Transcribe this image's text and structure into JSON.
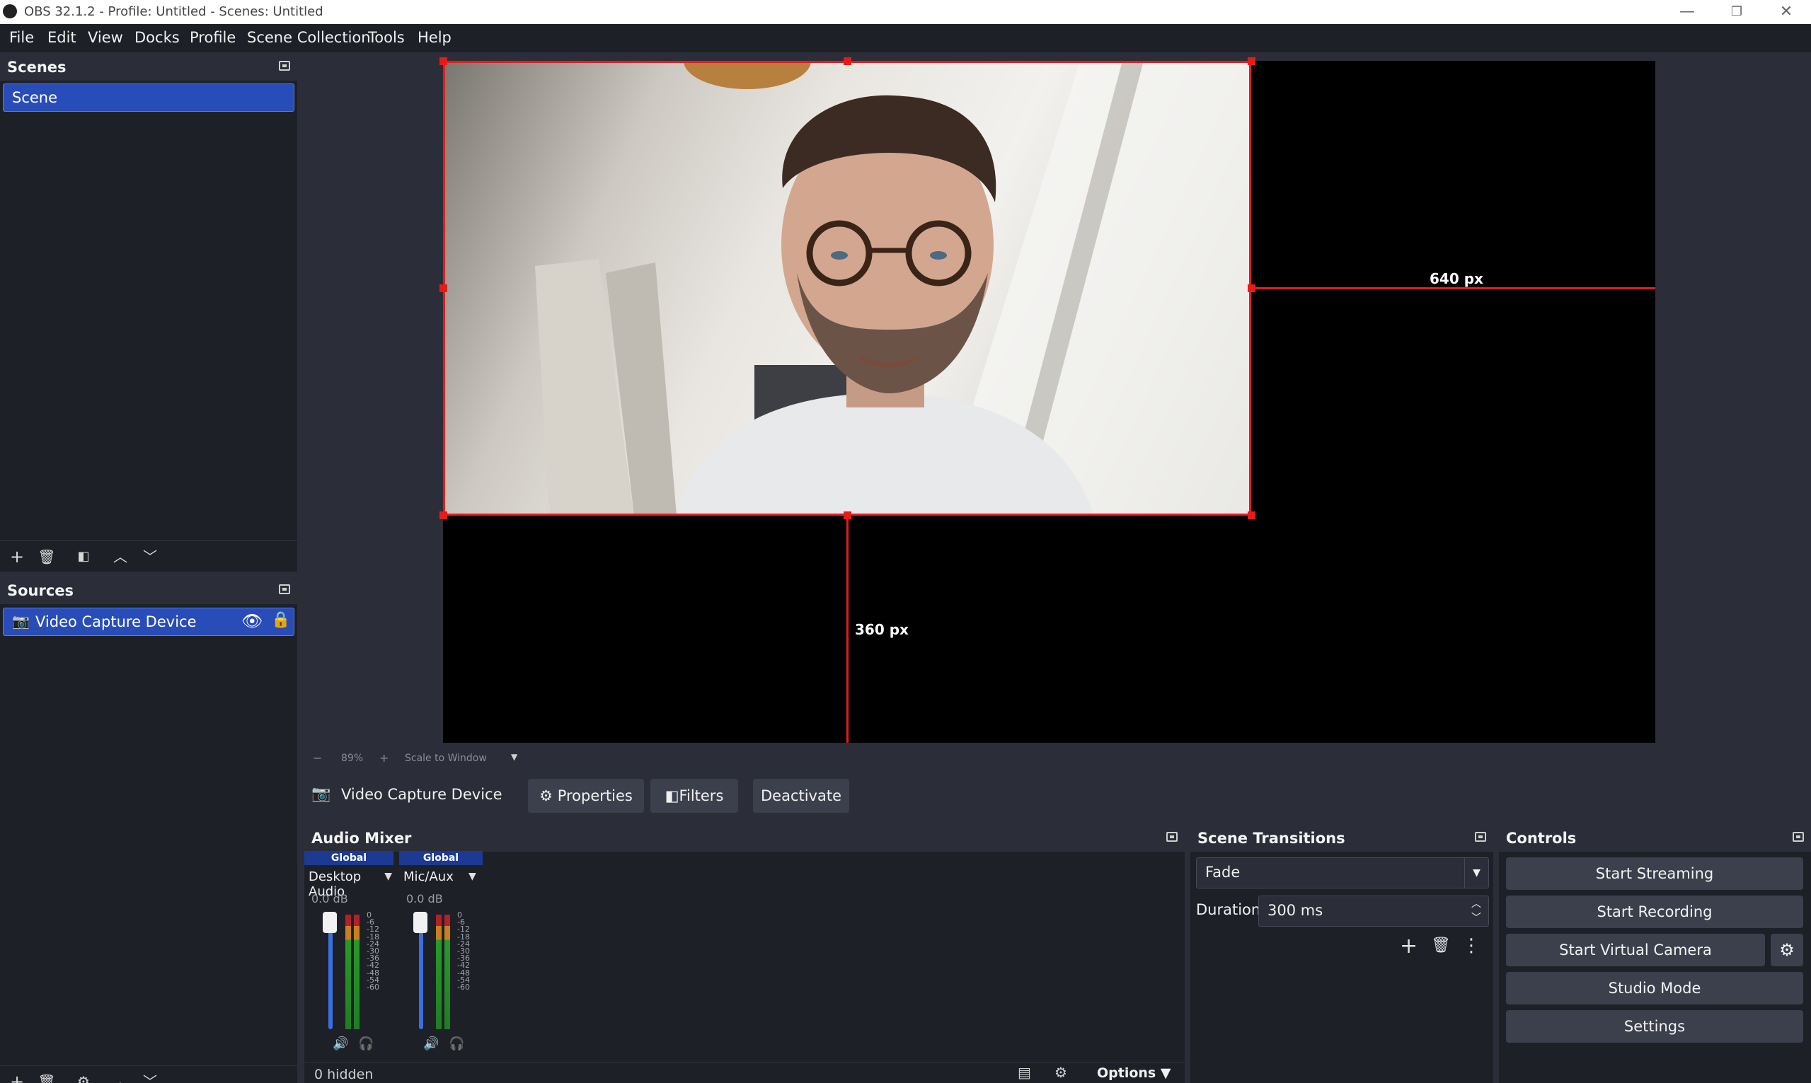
{
  "window": {
    "title": "OBS 32.1.2 - Profile: Untitled - Scenes: Untitled"
  },
  "menu": [
    "File",
    "Edit",
    "View",
    "Docks",
    "Profile",
    "Scene Collection",
    "Tools",
    "Help"
  ],
  "scenes": {
    "title": "Scenes",
    "items": [
      "Scene"
    ]
  },
  "sources": {
    "title": "Sources",
    "items": [
      "Video Capture Device"
    ]
  },
  "preview": {
    "width_label": "640 px",
    "height_label": "360 px"
  },
  "zoom": {
    "value": "89%",
    "scale_mode": "Scale to Window"
  },
  "source_toolbar": {
    "source_name": "Video Capture Device",
    "properties": "Properties",
    "filters": "Filters",
    "deactivate": "Deactivate"
  },
  "audio_mixer": {
    "title": "Audio Mixer",
    "channels": [
      {
        "badge": "Global",
        "name": "Desktop Audio",
        "level": "0.0 dB"
      },
      {
        "badge": "Global",
        "name": "Mic/Aux",
        "level": "0.0 dB"
      }
    ],
    "scale": [
      "0",
      "-6",
      "-12",
      "-18",
      "-24",
      "-30",
      "-36",
      "-42",
      "-48",
      "-54",
      "-60"
    ],
    "hidden_label": "0 hidden",
    "options_label": "Options"
  },
  "transitions": {
    "title": "Scene Transitions",
    "type": "Fade",
    "duration_label": "Duration",
    "duration": "300 ms"
  },
  "controls": {
    "title": "Controls",
    "start_streaming": "Start Streaming",
    "start_recording": "Start Recording",
    "start_virtual_camera": "Start Virtual Camera",
    "studio_mode": "Studio Mode",
    "settings": "Settings"
  },
  "colors": {
    "accent": "#284cb8",
    "selection_red": "#e81b1b",
    "panel": "#1e2028",
    "chrome": "#2b2e38"
  }
}
